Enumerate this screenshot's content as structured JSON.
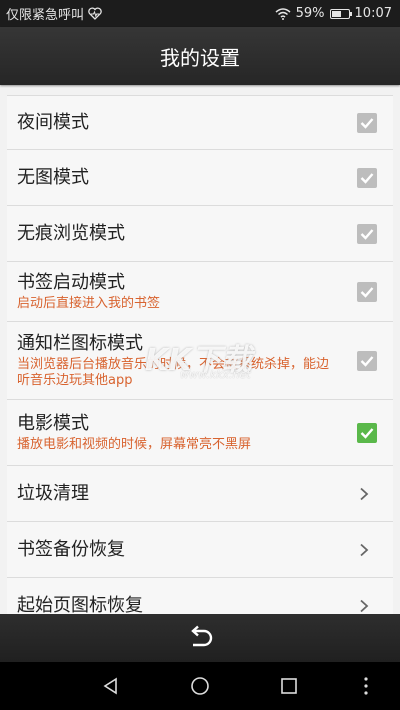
{
  "status_bar": {
    "left_text": "仅限紧急呼叫",
    "battery": "59%",
    "time": "10:07",
    "battery_level": 0.59
  },
  "header": {
    "title": "我的设置"
  },
  "settings": [
    {
      "title": "夜间模式",
      "subtitle": "",
      "control": "checkbox",
      "checked": true
    },
    {
      "title": "无图模式",
      "subtitle": "",
      "control": "checkbox",
      "checked": true
    },
    {
      "title": "无痕浏览模式",
      "subtitle": "",
      "control": "checkbox",
      "checked": true
    },
    {
      "title": "书签启动模式",
      "subtitle": "启动后直接进入我的书签",
      "control": "checkbox",
      "checked": true
    },
    {
      "title": "通知栏图标模式",
      "subtitle": "当浏览器后台播放音乐的时候，不会被系统杀掉，能边听音乐边玩其他app",
      "control": "checkbox",
      "checked": true
    },
    {
      "title": "电影模式",
      "subtitle": "播放电影和视频的时候，屏幕常亮不黑屏",
      "control": "checkbox",
      "checked": true
    },
    {
      "title": "垃圾清理",
      "subtitle": "",
      "control": "chevron"
    },
    {
      "title": "书签备份恢复",
      "subtitle": "",
      "control": "chevron"
    },
    {
      "title": "起始页图标恢复",
      "subtitle": "",
      "control": "chevron"
    }
  ],
  "watermark": {
    "text": "KK下载",
    "sub": "www.kkx.net"
  },
  "colors": {
    "subtitle": "#d8632f",
    "checkbox_on": "#5ab84a",
    "checkbox_off": "#bdbdbd",
    "title_bar": "#2e2e2e"
  },
  "icons": {
    "status_left": "heart-pulse-icon",
    "status_right": [
      "wifi-icon",
      "battery-icon"
    ],
    "bottom": "back-arrow-icon",
    "nav": [
      "nav-back-icon",
      "nav-home-icon",
      "nav-recents-icon",
      "nav-menu-icon"
    ]
  }
}
